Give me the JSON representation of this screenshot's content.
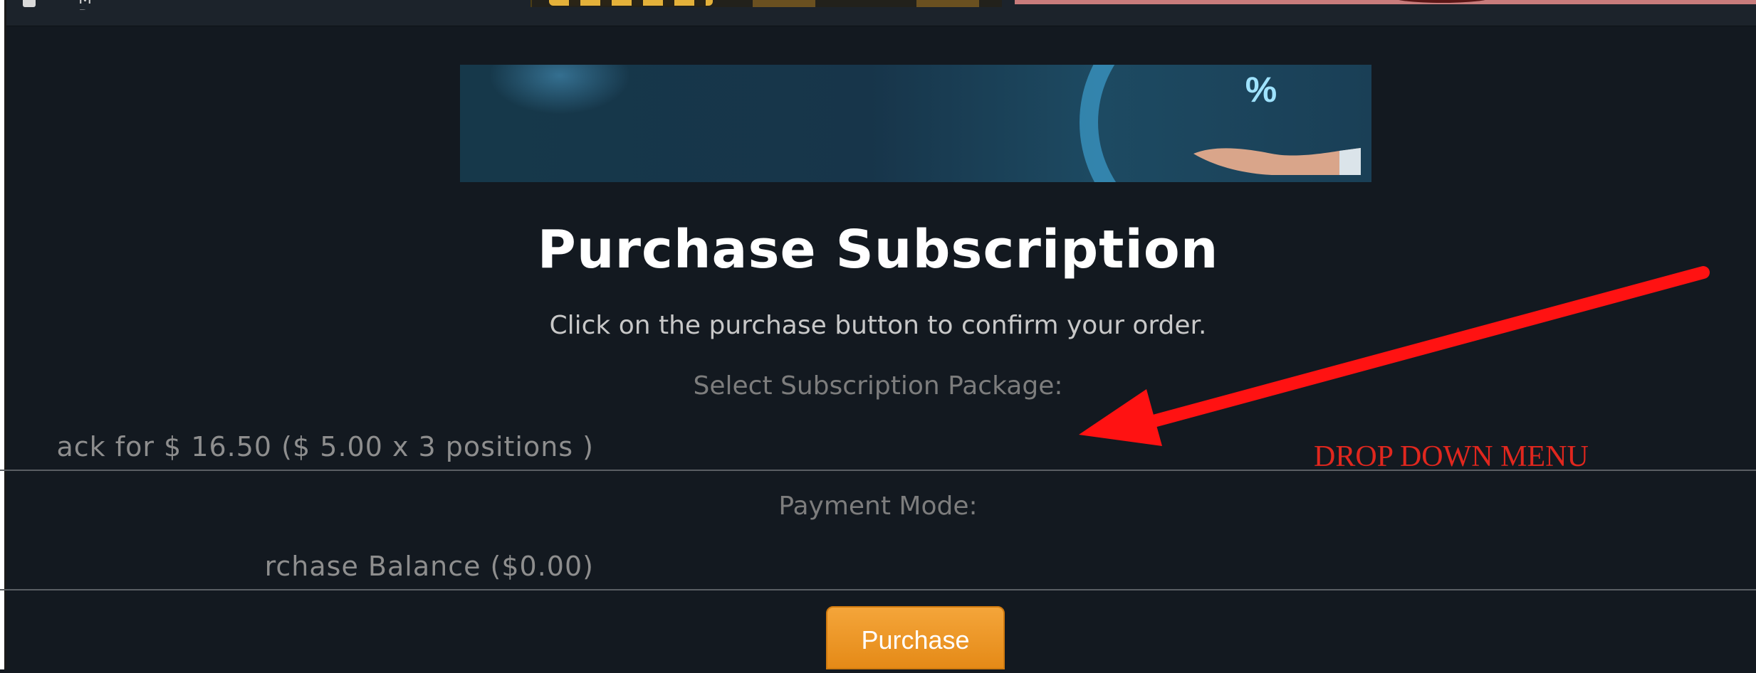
{
  "top_strip": {
    "nav_text": "M R...",
    "nav_icon": "menu-icon"
  },
  "banner": {
    "badge_text": "%",
    "description_icon": "percent-icon"
  },
  "page": {
    "title": "Purchase Subscription",
    "subtitle": "Click on the purchase button to confirm your order."
  },
  "form": {
    "package_label": "Select Subscription Package:",
    "package_value": "ack for $ 16.50 ($ 5.00 x 3 positions )",
    "payment_label": "Payment Mode:",
    "payment_value": "rchase Balance ($0.00)",
    "purchase_label": "Purchase"
  },
  "annotation": {
    "text": "DROP DOWN MENU",
    "color": "#e0271e"
  },
  "colors": {
    "background": "#131920",
    "button": "#ee9a2a",
    "banner": "#17354a"
  }
}
